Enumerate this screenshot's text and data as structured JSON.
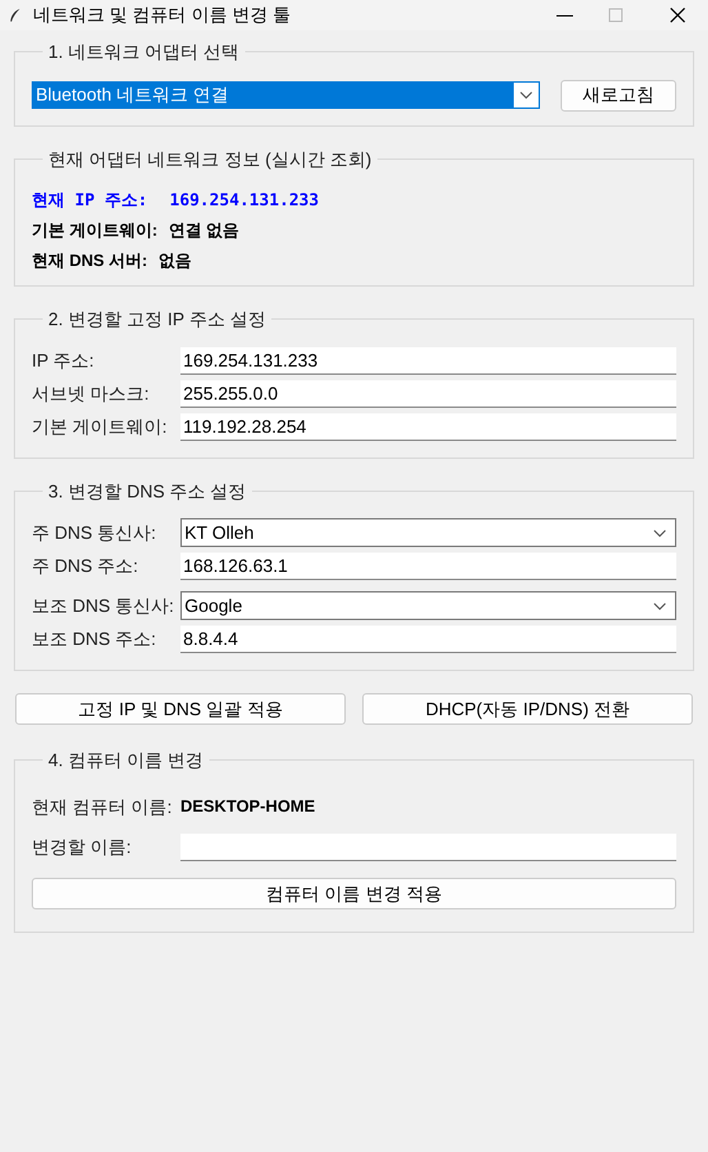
{
  "window": {
    "title": "네트워크 및 컴퓨터 이름 변경 툴"
  },
  "adapter_group": {
    "title": "1. 네트워크 어댑터 선택",
    "adapter": "Bluetooth 네트워크 연결",
    "refresh_button": "새로고침"
  },
  "info_group": {
    "title": "현재 어댑터 네트워크 정보 (실시간 조회)",
    "lines": [
      {
        "label": "현재 IP 주소:",
        "value": "169.254.131.233",
        "highlight": true
      },
      {
        "label": "기본 게이트웨이:",
        "value": "연결 없음",
        "highlight": false
      },
      {
        "label": "현재 DNS 서버:",
        "value": "없음",
        "highlight": false
      }
    ]
  },
  "ip_group": {
    "title": "2. 변경할 고정 IP 주소 설정",
    "rows": [
      {
        "kind": "text",
        "label": "IP 주소:",
        "value": "169.254.131.233"
      },
      {
        "kind": "text",
        "label": "서브넷 마스크:",
        "value": "255.255.0.0"
      },
      {
        "kind": "text",
        "label": "기본 게이트웨이:",
        "value": "119.192.28.254"
      }
    ]
  },
  "dns_group": {
    "title": "3. 변경할 DNS 주소 설정",
    "rows": [
      {
        "kind": "combo",
        "label": "주 DNS 통신사:",
        "value": "KT Olleh"
      },
      {
        "kind": "text",
        "label": "주 DNS 주소:",
        "value": "168.126.63.1"
      },
      {
        "kind": "combo",
        "label": "보조 DNS 통신사:",
        "value": "Google"
      },
      {
        "kind": "text",
        "label": "보조 DNS 주소:",
        "value": "8.8.4.4"
      }
    ]
  },
  "action_buttons": [
    "고정 IP 및 DNS 일괄 적용",
    "DHCP(자동 IP/DNS) 전환"
  ],
  "name_group": {
    "title": "4. 컴퓨터 이름 변경",
    "current_label": "현재 컴퓨터 이름:",
    "current_name": "DESKTOP-HOME",
    "new_label": "변경할 이름:",
    "apply_button": "컴퓨터 이름 변경 적용"
  }
}
